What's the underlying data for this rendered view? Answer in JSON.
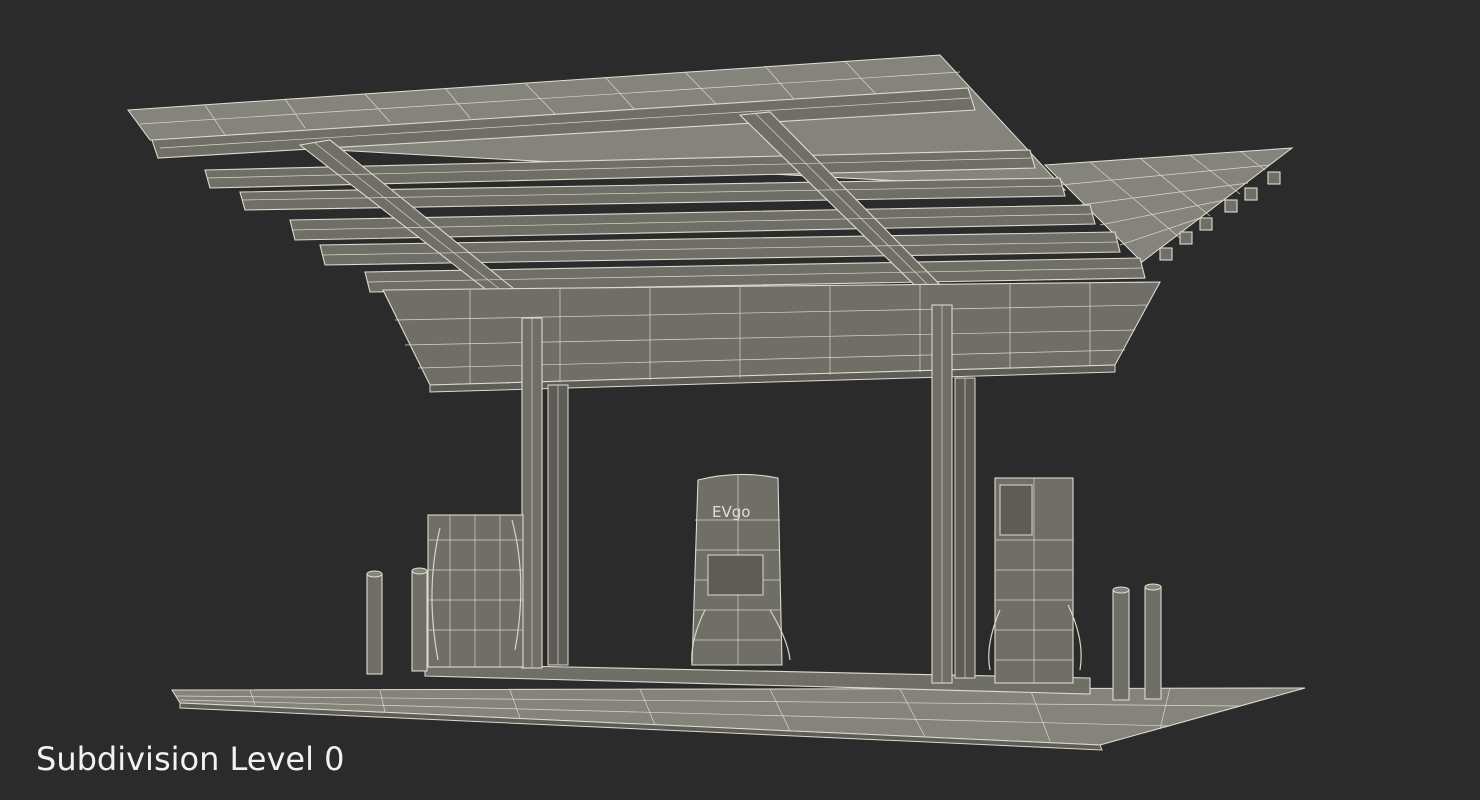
{
  "caption": {
    "text": "Subdivision Level 0"
  },
  "dispenser": {
    "brand": "EVgo"
  },
  "colors": {
    "background": "#2b2b2b",
    "wireframe": "#d9d6c8",
    "surface": "#6f6e67",
    "caption": "#f2f2f2"
  }
}
